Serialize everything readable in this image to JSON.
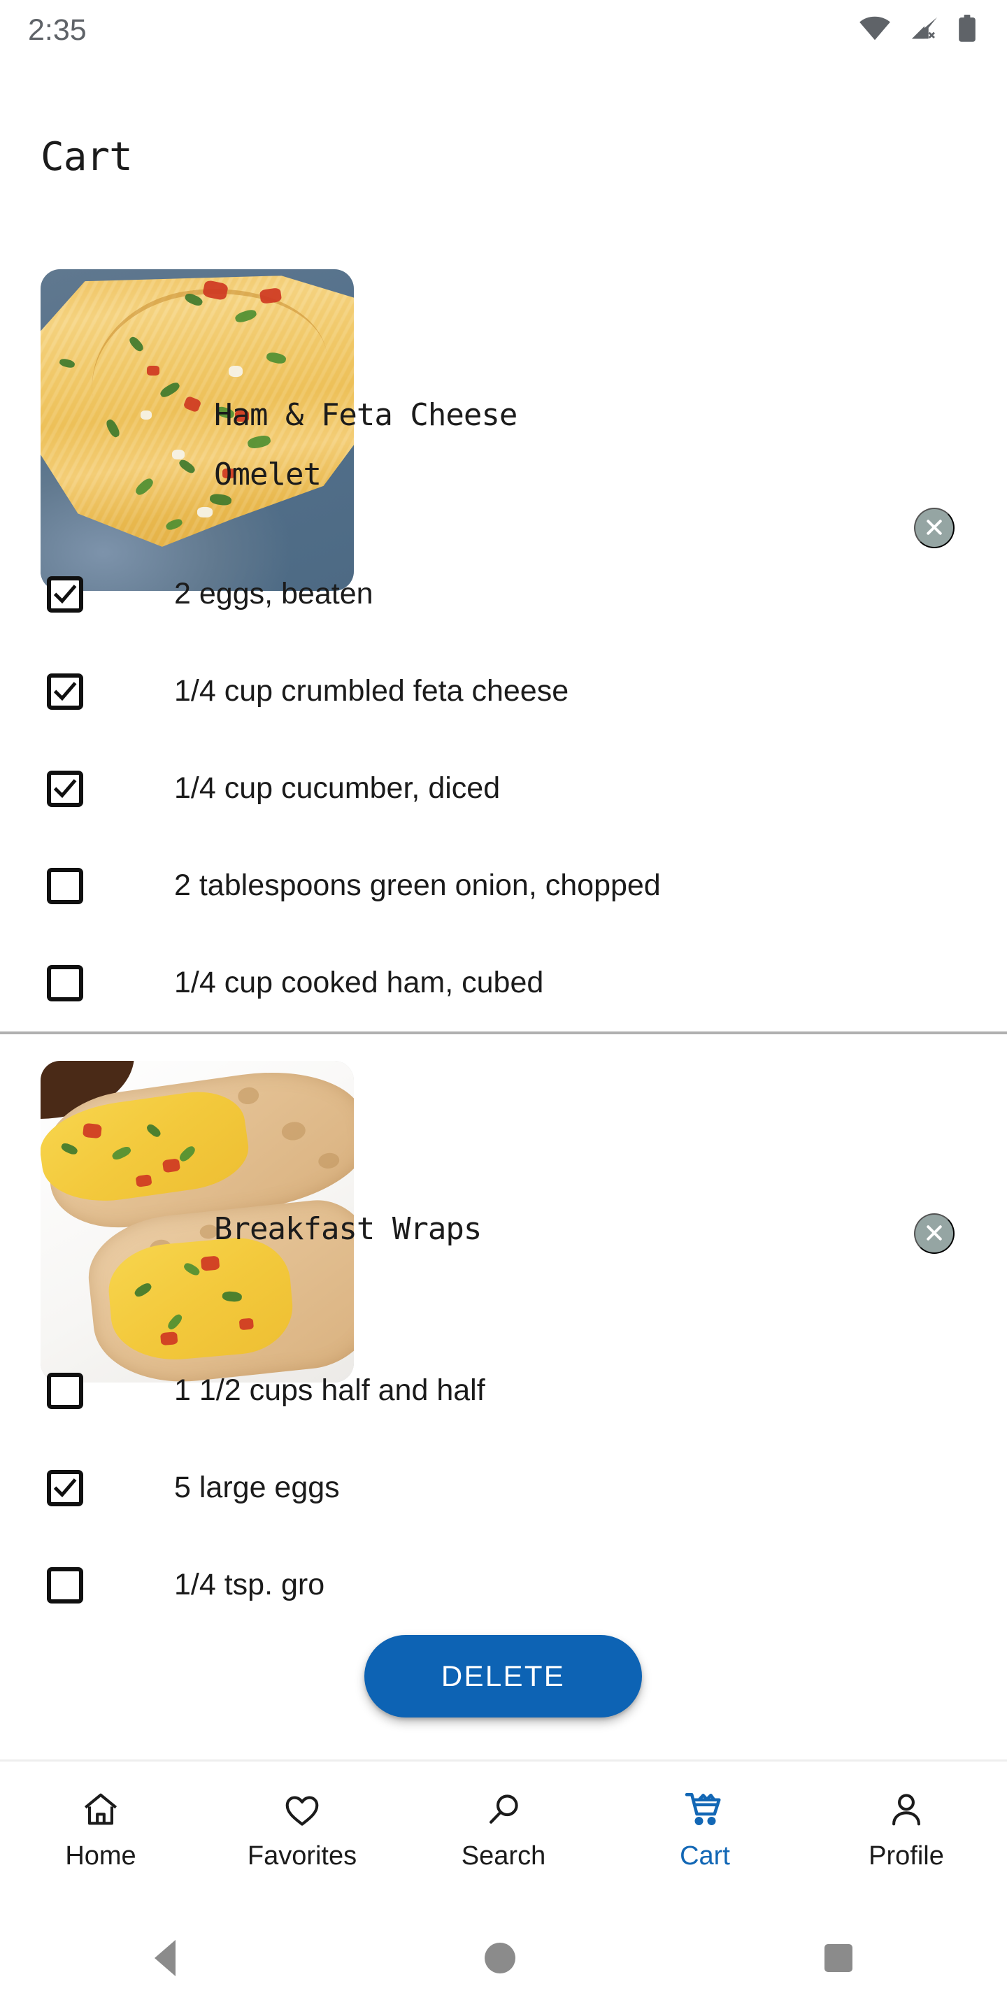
{
  "status_bar": {
    "time": "2:35",
    "icons": [
      "wifi-icon",
      "cellular-off-icon",
      "battery-icon"
    ],
    "icon_color": "#5f6368"
  },
  "header": {
    "title": "Cart"
  },
  "theme": {
    "accent": "#1267b5",
    "delete_button_bg": "#0d63b4",
    "close_button_bg": "#95a5a3",
    "divider": "#b0b0b0",
    "text": "#1b1b1b"
  },
  "cart": {
    "items": [
      {
        "title_line1": "Ham & Feta Cheese",
        "title_line2": "Omelet",
        "image_alt": "ham-and-feta-cheese-omelet-photo",
        "remove_label": "close-icon",
        "ingredients": [
          {
            "label": "2 eggs, beaten",
            "checked": true
          },
          {
            "label": "1/4 cup crumbled feta cheese",
            "checked": true
          },
          {
            "label": "1/4 cup cucumber, diced",
            "checked": true
          },
          {
            "label": "2 tablespoons green onion, chopped",
            "checked": false
          },
          {
            "label": "1/4 cup cooked ham, cubed",
            "checked": false
          }
        ]
      },
      {
        "title_line1": "Breakfast Wraps",
        "title_line2": "",
        "image_alt": "breakfast-wraps-photo",
        "remove_label": "close-icon",
        "ingredients": [
          {
            "label": "1 1/2 cups half and half",
            "checked": false
          },
          {
            "label": "5 large eggs",
            "checked": true
          },
          {
            "label": "1/4 tsp. gro",
            "checked": false
          }
        ]
      }
    ]
  },
  "delete_button": {
    "label": "DELETE"
  },
  "bottom_nav": {
    "items": [
      {
        "label": "Home",
        "icon": "home-icon",
        "active": false
      },
      {
        "label": "Favorites",
        "icon": "heart-icon",
        "active": false
      },
      {
        "label": "Search",
        "icon": "search-icon",
        "active": false
      },
      {
        "label": "Cart",
        "icon": "cart-icon",
        "active": true
      },
      {
        "label": "Profile",
        "icon": "person-icon",
        "active": false
      }
    ]
  },
  "system_nav": {
    "buttons": [
      "back-button",
      "home-button",
      "recents-button"
    ]
  }
}
